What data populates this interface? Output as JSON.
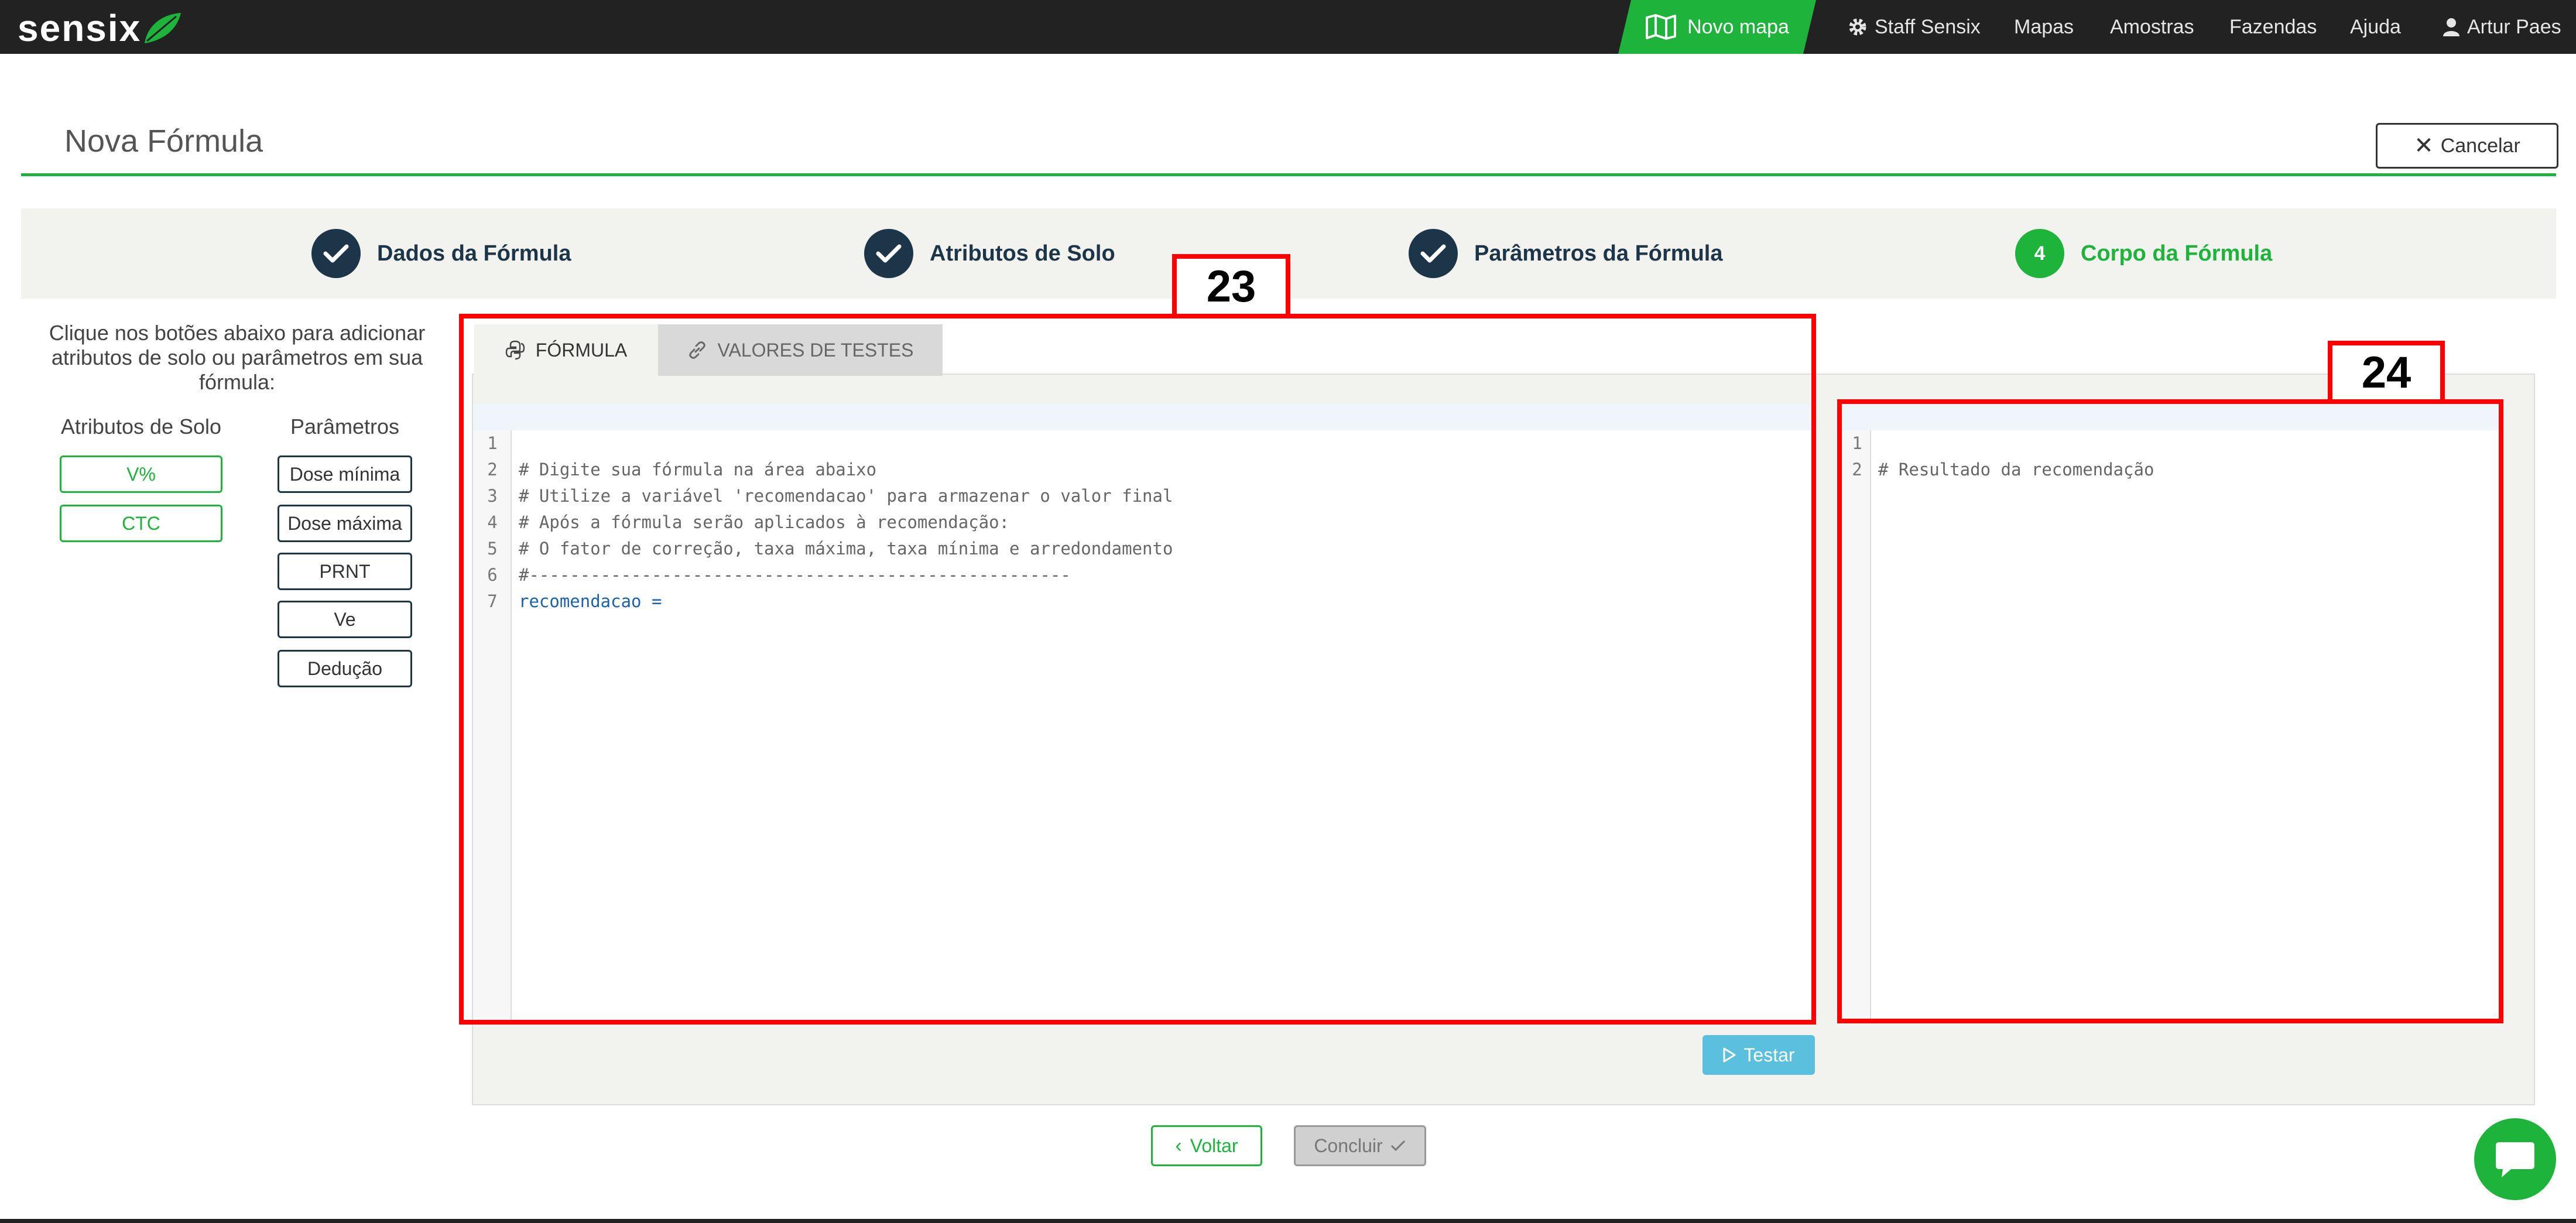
{
  "brand": {
    "logo_text": "sensix"
  },
  "nav": {
    "novo_mapa": "Novo mapa",
    "items": [
      "Staff Sensix",
      "Mapas",
      "Amostras",
      "Fazendas",
      "Ajuda",
      "Artur Paes"
    ]
  },
  "header": {
    "title": "Nova Fórmula",
    "cancel_label": "Cancelar"
  },
  "stepper": {
    "steps": [
      {
        "label": "Dados da Fórmula",
        "state": "done"
      },
      {
        "label": "Atributos de Solo",
        "state": "done"
      },
      {
        "label": "Parâmetros da Fórmula",
        "state": "done"
      },
      {
        "label": "Corpo da Fórmula",
        "state": "active",
        "number": "4"
      }
    ]
  },
  "left_panel": {
    "instructions": "Clique nos botões abaixo para adicionar atributos de solo ou parâmetros em sua fórmula:",
    "attributes_heading": "Atributos de Solo",
    "parameters_heading": "Parâmetros",
    "attributes": [
      "V%",
      "CTC"
    ],
    "parameters": [
      "Dose mínima",
      "Dose máxima",
      "PRNT",
      "Ve",
      "Dedução"
    ]
  },
  "tabs": [
    {
      "label": "FÓRMULA",
      "active": true
    },
    {
      "label": "VALORES DE TESTES",
      "active": false
    }
  ],
  "formula_editor": {
    "lines": [
      {
        "n": "1",
        "text": "# Digite sua fórmula na área abaixo"
      },
      {
        "n": "2",
        "text": "# Utilize a variável 'recomendacao' para armazenar o valor final"
      },
      {
        "n": "3",
        "text": "# Após a fórmula serão aplicados à recomendação:"
      },
      {
        "n": "4",
        "text": "# O fator de correção, taxa máxima, taxa mínima e arredondamento"
      },
      {
        "n": "5",
        "text": "#-----------------------------------------------------"
      },
      {
        "n": "6",
        "text": "recomendacao ="
      },
      {
        "n": "7",
        "text": ""
      }
    ]
  },
  "result_editor": {
    "lines": [
      {
        "n": "1",
        "text": "# Resultado da recomendação"
      },
      {
        "n": "2",
        "text": ""
      }
    ]
  },
  "actions": {
    "test_label": "Testar",
    "back_label": "Voltar",
    "finish_label": "Concluir"
  },
  "annotations": {
    "box_a": "23",
    "box_b": "24"
  },
  "colors": {
    "accent": "#1eb33b",
    "navy": "#1d3549",
    "navbar": "#222222",
    "test_button": "#5bc0de",
    "annotation": "#ff0000"
  }
}
